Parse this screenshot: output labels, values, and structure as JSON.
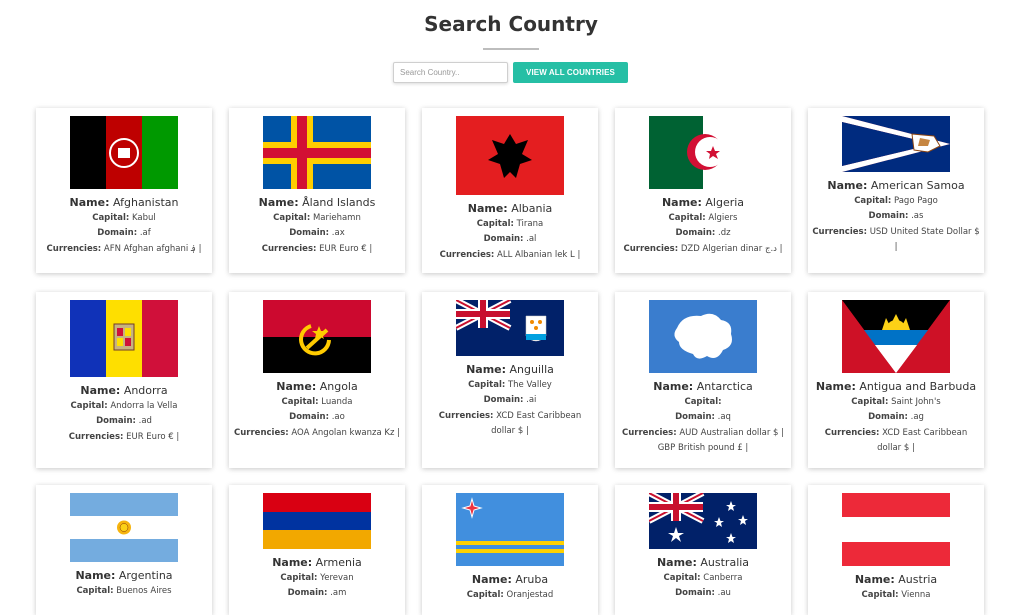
{
  "header": {
    "title": "Search Country",
    "search_placeholder": "Search Country..",
    "view_all_label": "VIEW ALL COUNTRIES"
  },
  "labels": {
    "name": "Name:",
    "capital": "Capital:",
    "domain": "Domain:",
    "currencies": "Currencies:"
  },
  "countries": [
    {
      "name": "Afghanistan",
      "capital": "Kabul",
      "domain": ".af",
      "currencies": "AFN Afghan afghani ؋ |"
    },
    {
      "name": "Åland Islands",
      "capital": "Mariehamn",
      "domain": ".ax",
      "currencies": "EUR Euro € |"
    },
    {
      "name": "Albania",
      "capital": "Tirana",
      "domain": ".al",
      "currencies": "ALL Albanian lek L |"
    },
    {
      "name": "Algeria",
      "capital": "Algiers",
      "domain": ".dz",
      "currencies": "DZD Algerian dinar د.ج |"
    },
    {
      "name": "American Samoa",
      "capital": "Pago Pago",
      "domain": ".as",
      "currencies": "USD United State Dollar $ |"
    },
    {
      "name": "Andorra",
      "capital": "Andorra la Vella",
      "domain": ".ad",
      "currencies": "EUR Euro € |"
    },
    {
      "name": "Angola",
      "capital": "Luanda",
      "domain": ".ao",
      "currencies": "AOA Angolan kwanza Kz |"
    },
    {
      "name": "Anguilla",
      "capital": "The Valley",
      "domain": ".ai",
      "currencies": "XCD East Caribbean dollar $ |"
    },
    {
      "name": "Antarctica",
      "capital": "",
      "domain": ".aq",
      "currencies": "AUD Australian dollar $ | GBP British pound £ |"
    },
    {
      "name": "Antigua and Barbuda",
      "capital": "Saint John's",
      "domain": ".ag",
      "currencies": "XCD East Caribbean dollar $ |"
    },
    {
      "name": "Argentina",
      "capital": "Buenos Aires",
      "domain": "",
      "currencies": ""
    },
    {
      "name": "Armenia",
      "capital": "Yerevan",
      "domain": ".am",
      "currencies": ""
    },
    {
      "name": "Aruba",
      "capital": "Oranjestad",
      "domain": "",
      "currencies": ""
    },
    {
      "name": "Australia",
      "capital": "Canberra",
      "domain": ".au",
      "currencies": ""
    },
    {
      "name": "Austria",
      "capital": "Vienna",
      "domain": "",
      "currencies": ""
    }
  ],
  "flag_icons": [
    "afghanistan-flag-icon",
    "aland-flag-icon",
    "albania-flag-icon",
    "algeria-flag-icon",
    "american-samoa-flag-icon",
    "andorra-flag-icon",
    "angola-flag-icon",
    "anguilla-flag-icon",
    "antarctica-flag-icon",
    "antigua-barbuda-flag-icon",
    "argentina-flag-icon",
    "armenia-flag-icon",
    "aruba-flag-icon",
    "australia-flag-icon",
    "austria-flag-icon"
  ],
  "colors": {
    "accent": "#26bfa5",
    "text": "#333333",
    "card_bg": "#ffffff"
  }
}
